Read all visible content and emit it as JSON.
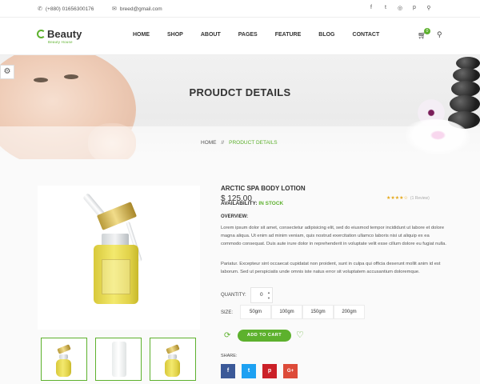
{
  "topbar": {
    "phone": "(+880) 01656300176",
    "email": "breed@gmail.com",
    "phone_icon": "phone-icon",
    "mail_icon": "envelope-icon",
    "social": [
      "f",
      "t",
      "◎",
      "p",
      "⚲"
    ]
  },
  "header": {
    "logo_name": "Beauty",
    "logo_tag": "Beauty House",
    "nav": [
      "HOME",
      "SHOP",
      "ABOUT",
      "PAGES",
      "FEATURE",
      "BLOG",
      "CONTACT"
    ],
    "cart_count": "0"
  },
  "banner": {
    "title": "PROUDCT DETAILS",
    "breadcrumb_home": "HOME",
    "breadcrumb_sep": "//",
    "breadcrumb_current": "PRODUCT DETAILS"
  },
  "product": {
    "title": "ARCTIC SPA BODY LOTION",
    "price": "$ 125.00",
    "rating_stars": "★★★★☆",
    "rating_text": "(1 Review)",
    "availability_label": "AVAILABILITY:",
    "availability_value": "IN STOCK",
    "overview_label": "OVERVIEW:",
    "overview_p1": "Lorem ipsum dolor sit amet, consectetur adipisicing elit, sed do eiusmod tempor incididunt ut labore et dolore magna aliqua. Ut enim ad minim veniam, quis nostrud exercitation ullamco laboris nisi ut aliquip ex ea commodo consequat. Duis aute irure dolor in reprehenderit in voluptate velit esse cillum dolore eu fugiat nulla.",
    "overview_p2": "Pariatur. Excepteur sint occaecat cupidatat non proident, sunt in culpa qui officia deserunt mollit anim id est laborum. Sed ut perspiciatis unde omnis iste natus error sit voluptatem accusantium doloremque.",
    "quantity_label": "QUANTITY:",
    "quantity_value": "0",
    "size_label": "SIZE:",
    "sizes": [
      "50gm",
      "100gm",
      "150gm",
      "200gm"
    ],
    "add_to_cart": "ADD TO CART",
    "share_label": "SHARE:",
    "share_buttons": [
      "f",
      "t",
      "p",
      "G+"
    ]
  },
  "colors": {
    "accent": "#5db12d",
    "facebook": "#3b5998",
    "twitter": "#1da1f2",
    "pinterest": "#cb2027",
    "google": "#dd4b39"
  }
}
